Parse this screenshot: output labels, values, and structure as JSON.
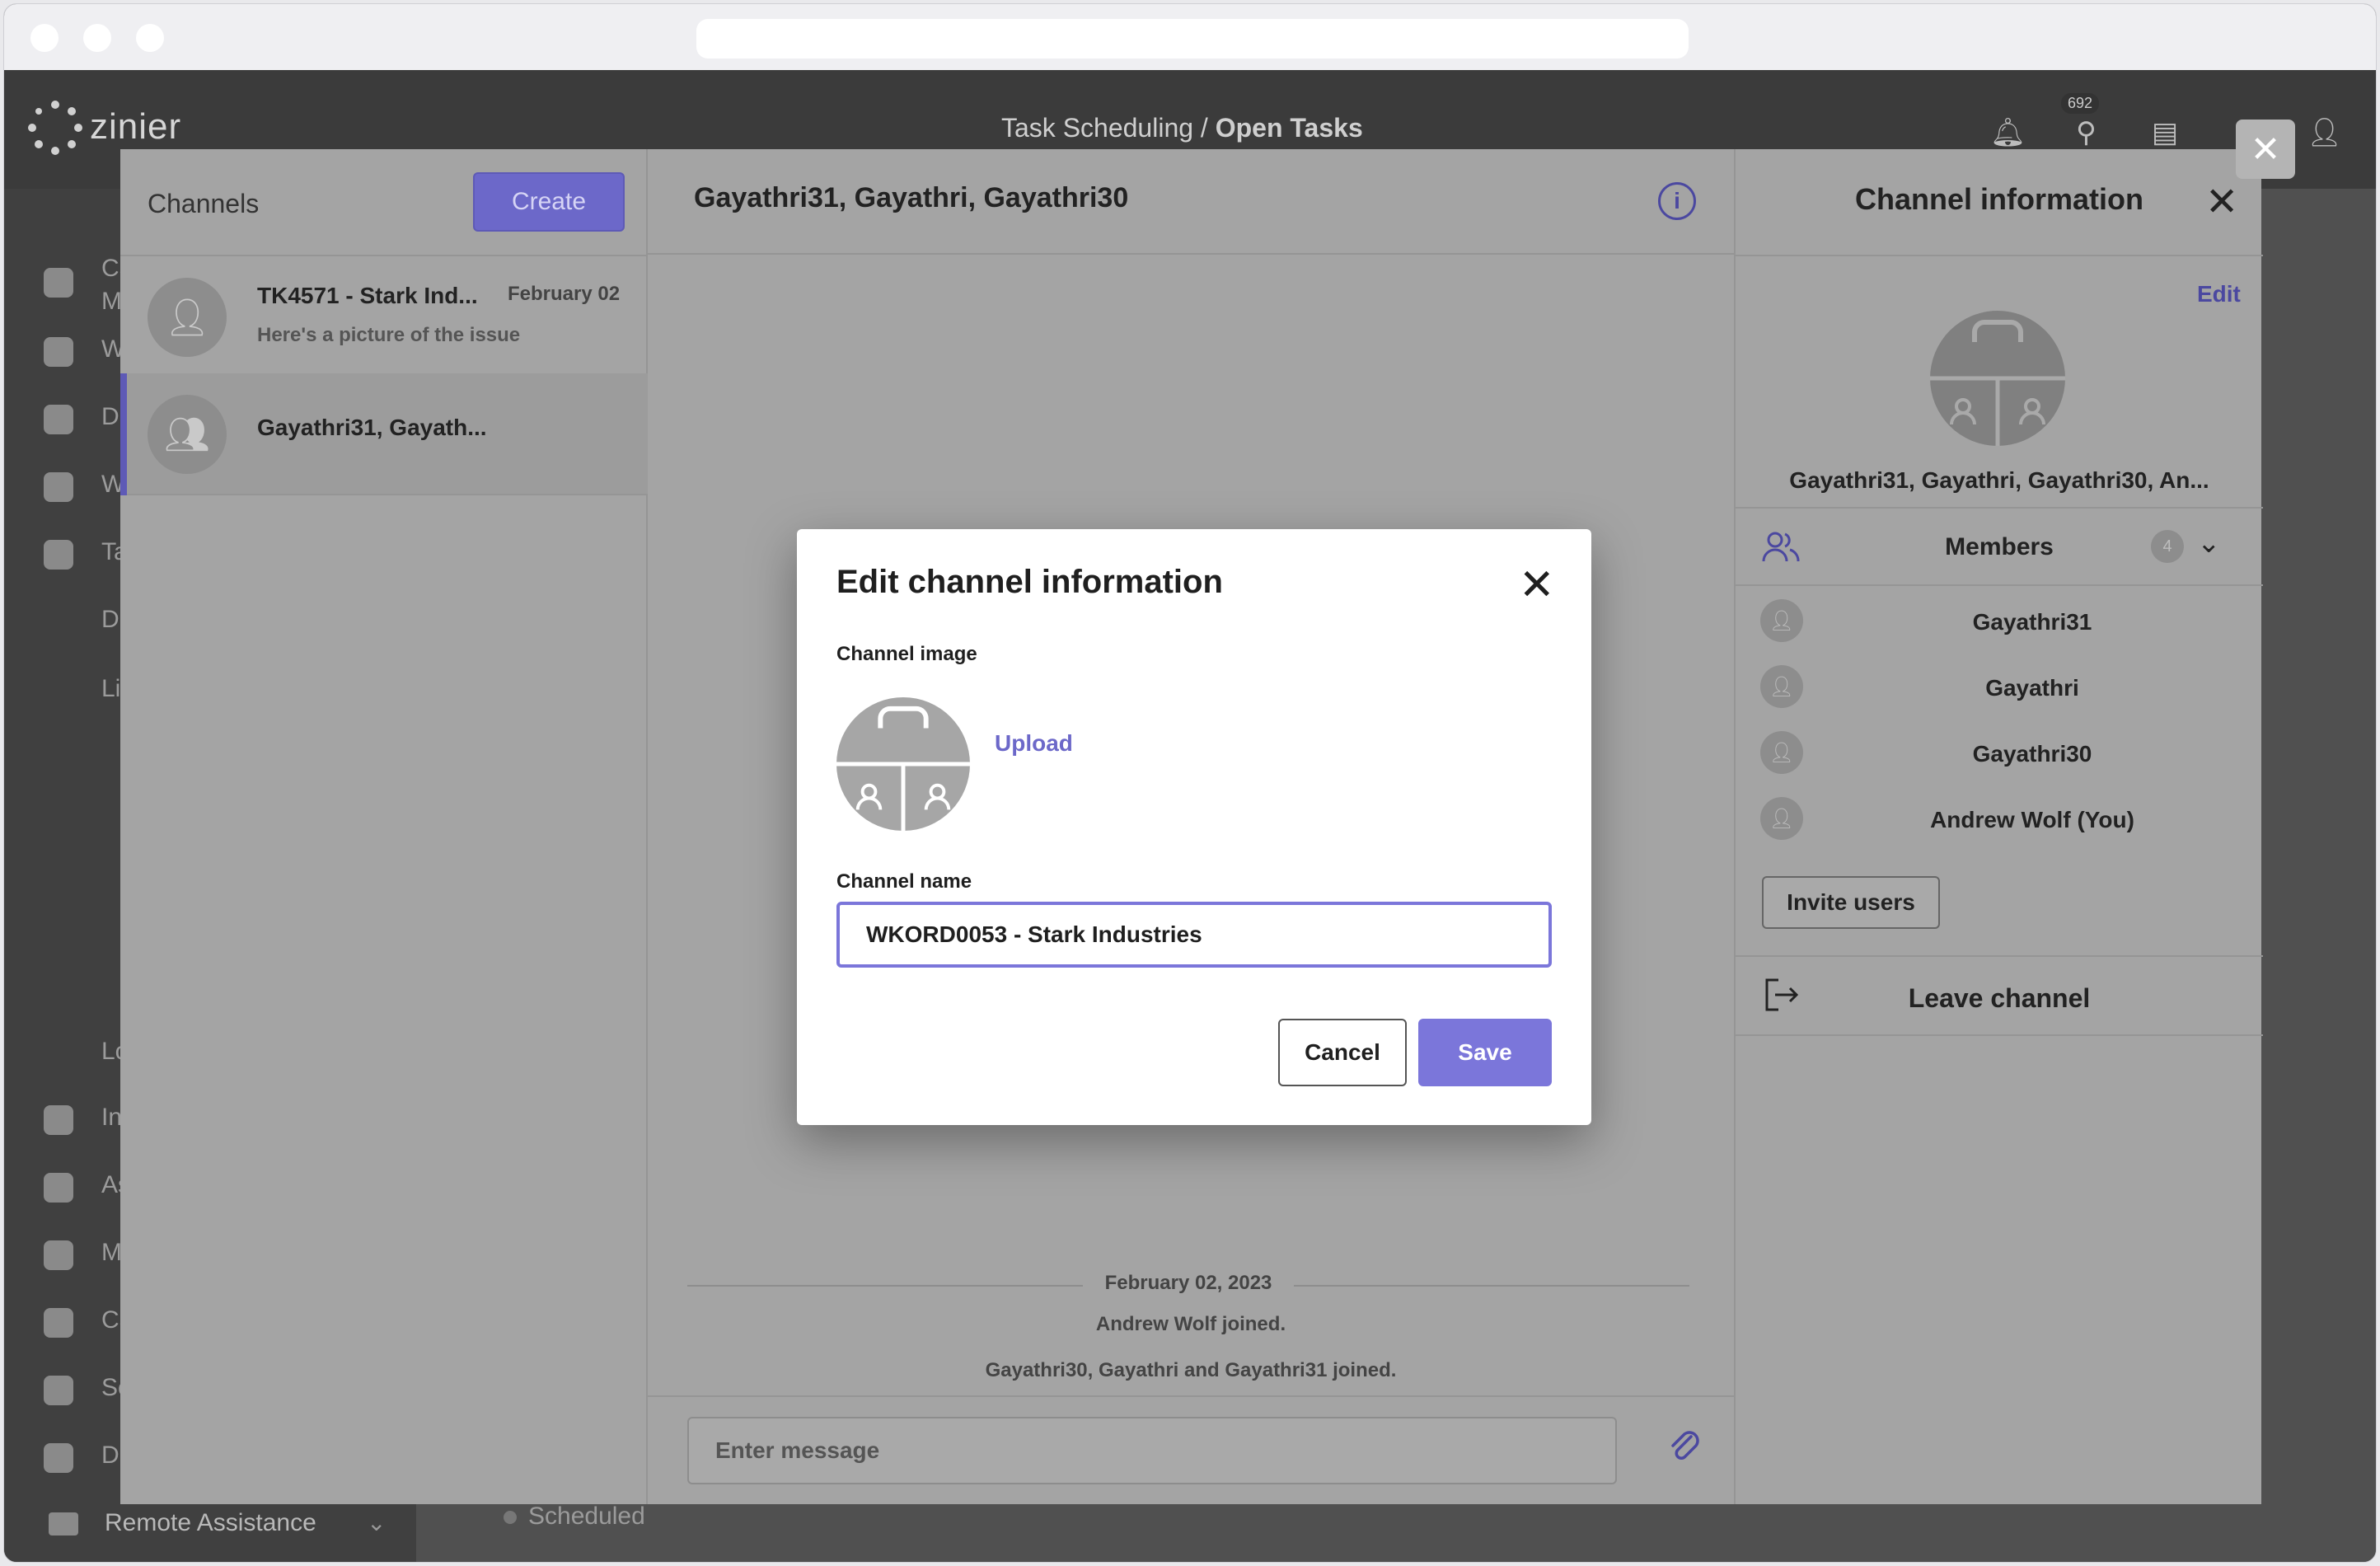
{
  "app": {
    "logo_text": "zinier",
    "breadcrumb_parent": "Task Scheduling /",
    "breadcrumb_current": "Open Tasks",
    "notification_badge": "692",
    "sidebar_partial": [
      "Ca",
      "M",
      "W",
      "D",
      "W",
      "Ta",
      "D",
      "Li",
      "Lo",
      "In",
      "As",
      "M",
      "Ca",
      "Se",
      "D"
    ],
    "remote_assistance_label": "Remote Assistance",
    "scheduled_label": "Scheduled"
  },
  "channels": {
    "title": "Channels",
    "create_label": "Create",
    "items": [
      {
        "name": "TK4571 - Stark Ind...",
        "date": "February 02",
        "preview": "Here's a picture of the issue"
      },
      {
        "name": "Gayathri31, Gayath..."
      }
    ]
  },
  "conversation": {
    "title": "Gayathri31, Gayathri, Gayathri30",
    "info_icon_label": "i",
    "date_separator": "February 02, 2023",
    "system_messages": [
      "Andrew Wolf joined.",
      "Gayathri30, Gayathri and Gayathri31 joined."
    ],
    "input_placeholder": "Enter message"
  },
  "channel_info": {
    "title": "Channel information",
    "edit_label": "Edit",
    "channel_names": "Gayathri31, Gayathri, Gayathri30, An...",
    "members_label": "Members",
    "members_count": "4",
    "members": [
      "Gayathri31",
      "Gayathri",
      "Gayathri30",
      "Andrew Wolf (You)"
    ],
    "invite_label": "Invite users",
    "leave_label": "Leave channel"
  },
  "modal": {
    "title": "Edit channel information",
    "image_label": "Channel image",
    "upload_label": "Upload",
    "name_label": "Channel name",
    "name_value": "WKORD0053 - Stark Industries",
    "cancel_label": "Cancel",
    "save_label": "Save"
  },
  "colors": {
    "accent": "#7b76da",
    "accent_dark": "#4b48a0",
    "overlay": "#a4a4a4"
  }
}
